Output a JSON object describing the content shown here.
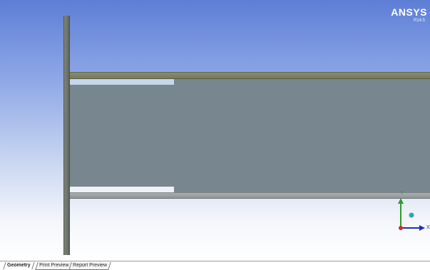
{
  "logo": {
    "title": "ANSYS",
    "version": "R14.5"
  },
  "triad": {
    "y_label": "Y",
    "x_label": "X",
    "y_color": "#2f9a2f",
    "x_color": "#1f2fb8",
    "origin_color": "#c83020",
    "iso_color": "#2aa7b7"
  },
  "tabs": [
    {
      "label": "Geometry",
      "active": true
    },
    {
      "label": "Print Preview",
      "active": false
    },
    {
      "label": "Report Preview",
      "active": false
    }
  ]
}
